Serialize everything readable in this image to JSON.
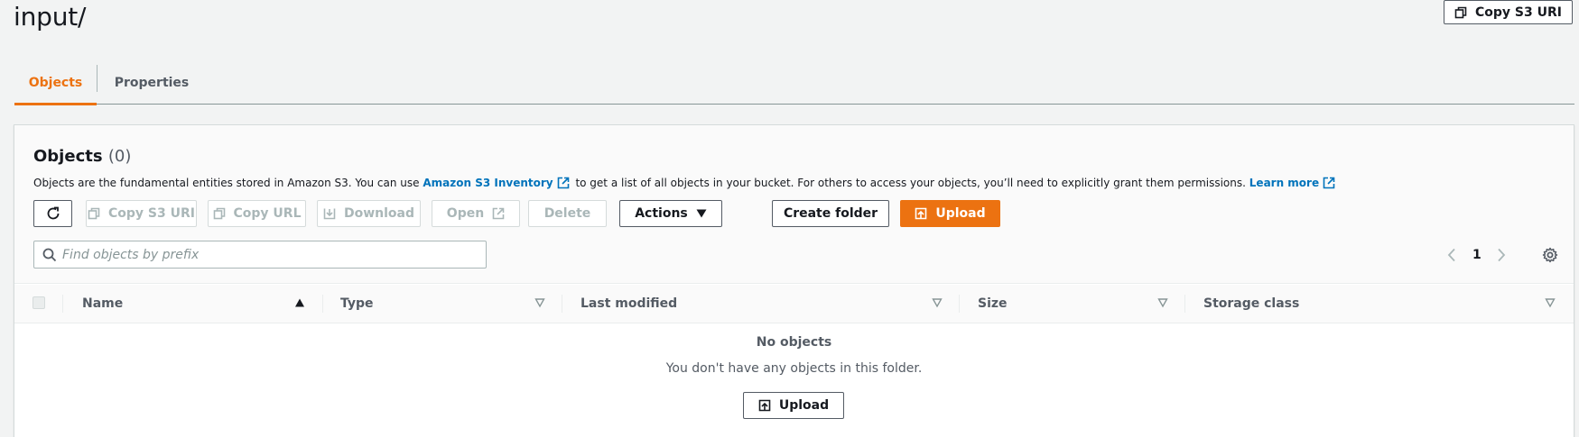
{
  "page": {
    "title": "input/"
  },
  "header_actions": {
    "copy_s3_uri": "Copy S3 URI"
  },
  "tabs": [
    {
      "label": "Objects",
      "active": true
    },
    {
      "label": "Properties",
      "active": false
    }
  ],
  "objects_panel": {
    "title": "Objects",
    "count": "(0)",
    "description": {
      "part1": "Objects are the fundamental entities stored in Amazon S3. You can use",
      "link1": "Amazon S3 Inventory",
      "part2": "to get a list of all objects in your bucket. For others to access your objects, you’ll need to explicitly grant them permissions.",
      "link2": "Learn more"
    },
    "toolbar": {
      "copy_s3_uri": "Copy S3 URI",
      "copy_url": "Copy URL",
      "download": "Download",
      "open": "Open",
      "delete": "Delete",
      "actions": "Actions",
      "create_folder": "Create folder",
      "upload": "Upload"
    },
    "search": {
      "placeholder": "Find objects by prefix",
      "value": ""
    },
    "pagination": {
      "current_page": "1"
    }
  },
  "table": {
    "columns": [
      "Name",
      "Type",
      "Last modified",
      "Size",
      "Storage class"
    ],
    "sorted_column": "Name",
    "sort_direction": "ascending"
  },
  "empty_state": {
    "title": "No objects",
    "description": "You don't have any objects in this folder.",
    "upload": "Upload"
  },
  "colors": {
    "accent": "#ec7211",
    "link": "#0073bb",
    "text": "#16191f",
    "muted": "#545b64",
    "disabled": "#aab7b8"
  }
}
